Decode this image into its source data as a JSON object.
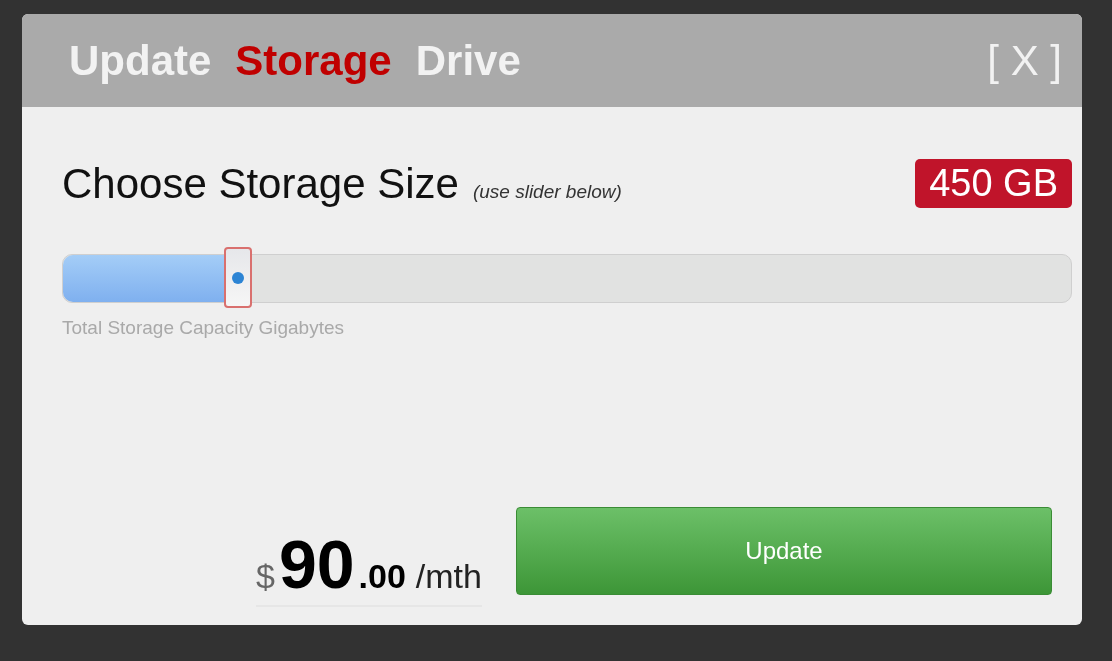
{
  "dialog": {
    "title_parts": [
      {
        "text": "Update",
        "highlight": false
      },
      {
        "text": "Storage",
        "highlight": true
      },
      {
        "text": "Drive",
        "highlight": false
      }
    ],
    "close": "[ X ]"
  },
  "storage": {
    "heading": "Choose Storage Size",
    "hint": "(use slider below)",
    "value_badge": "450 GB"
  },
  "slider": {
    "level": 0.174,
    "caption": "Total Storage Capacity Gigabytes"
  },
  "price": {
    "currency": "$",
    "whole": "90",
    "cents": ".00",
    "unit": "/mth"
  },
  "button": "Update"
}
